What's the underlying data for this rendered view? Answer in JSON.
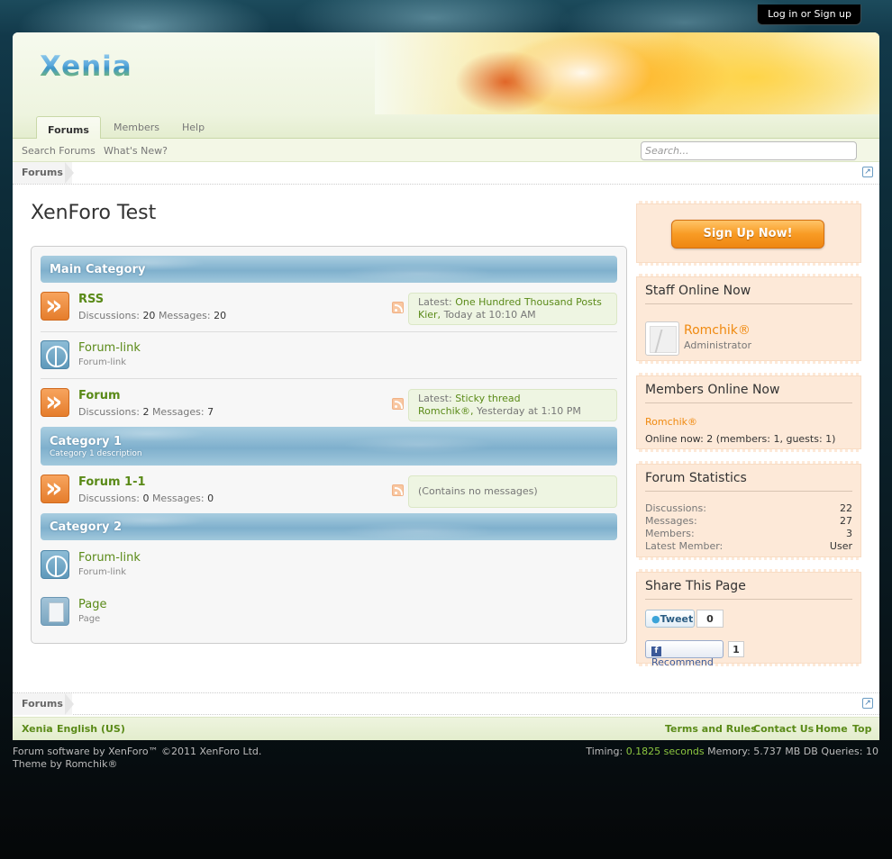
{
  "login": "Log in or Sign up",
  "logo": "Xenia",
  "navtabs": [
    {
      "label": "Forums"
    },
    {
      "label": "Members"
    },
    {
      "label": "Help"
    }
  ],
  "subnav": {
    "links": [
      "Search Forums",
      "What's New?"
    ],
    "search_placeholder": "Search..."
  },
  "breadcrumb": "Forums",
  "title": "XenForo Test",
  "categories": [
    {
      "title": "Main Category"
    },
    {
      "title": "Category 1",
      "description": "Category 1 description"
    },
    {
      "title": "Category 2"
    }
  ],
  "nodes": [
    {
      "title": "RSS",
      "discussions_label": "Discussions:",
      "discussions": "20",
      "messages_label": "Messages:",
      "messages": "20",
      "latest_label": "Latest:",
      "latest_thread": "One Hundred Thousand Posts",
      "latest_user": "Kier,",
      "latest_time": "Today at 10:10 AM"
    },
    {
      "title": "Forum-link",
      "description": "Forum-link"
    },
    {
      "title": "Forum",
      "discussions_label": "Discussions:",
      "discussions": "2",
      "messages_label": "Messages:",
      "messages": "7",
      "latest_label": "Latest:",
      "latest_thread": "Sticky thread",
      "latest_user": "Romchik®,",
      "latest_time": "Yesterday at 1:10 PM"
    },
    {
      "title": "Forum 1-1",
      "discussions_label": "Discussions:",
      "discussions": "0",
      "messages_label": "Messages:",
      "messages": "0",
      "empty": "(Contains no messages)"
    },
    {
      "title": "Forum-link",
      "description": "Forum-link"
    },
    {
      "title": "Page",
      "description": "Page"
    }
  ],
  "sidebar": {
    "signup": "Sign Up Now!",
    "staff_title": "Staff Online Now",
    "staff_name": "Romchik®",
    "staff_role": "Administrator",
    "members_title": "Members Online Now",
    "members_list": "Romchik®",
    "online_now": "Online now: 2 (members: 1, guests: 1)",
    "stats_title": "Forum Statistics",
    "stats": [
      {
        "label": "Discussions:",
        "value": "22"
      },
      {
        "label": "Messages:",
        "value": "27"
      },
      {
        "label": "Members:",
        "value": "3"
      },
      {
        "label": "Latest Member:",
        "value": "User"
      }
    ],
    "share_title": "Share This Page",
    "tweet": "Tweet",
    "tweet_count": "0",
    "recommend": "Recommend",
    "recommend_count": "1"
  },
  "footer": {
    "crumb": "Forums",
    "left_links": [
      "Xenia",
      "English (US)"
    ],
    "right_links": [
      "Terms and Rules",
      "Contact Us",
      "Home",
      "Top"
    ],
    "copyright": "Forum software by XenForo™ ©2011 XenForo Ltd.",
    "theme": "Theme by Romchik®",
    "timing_label": "Timing:",
    "timing_value": "0.1825 seconds",
    "memory": "Memory: 5.737 MB DB Queries: 10"
  }
}
